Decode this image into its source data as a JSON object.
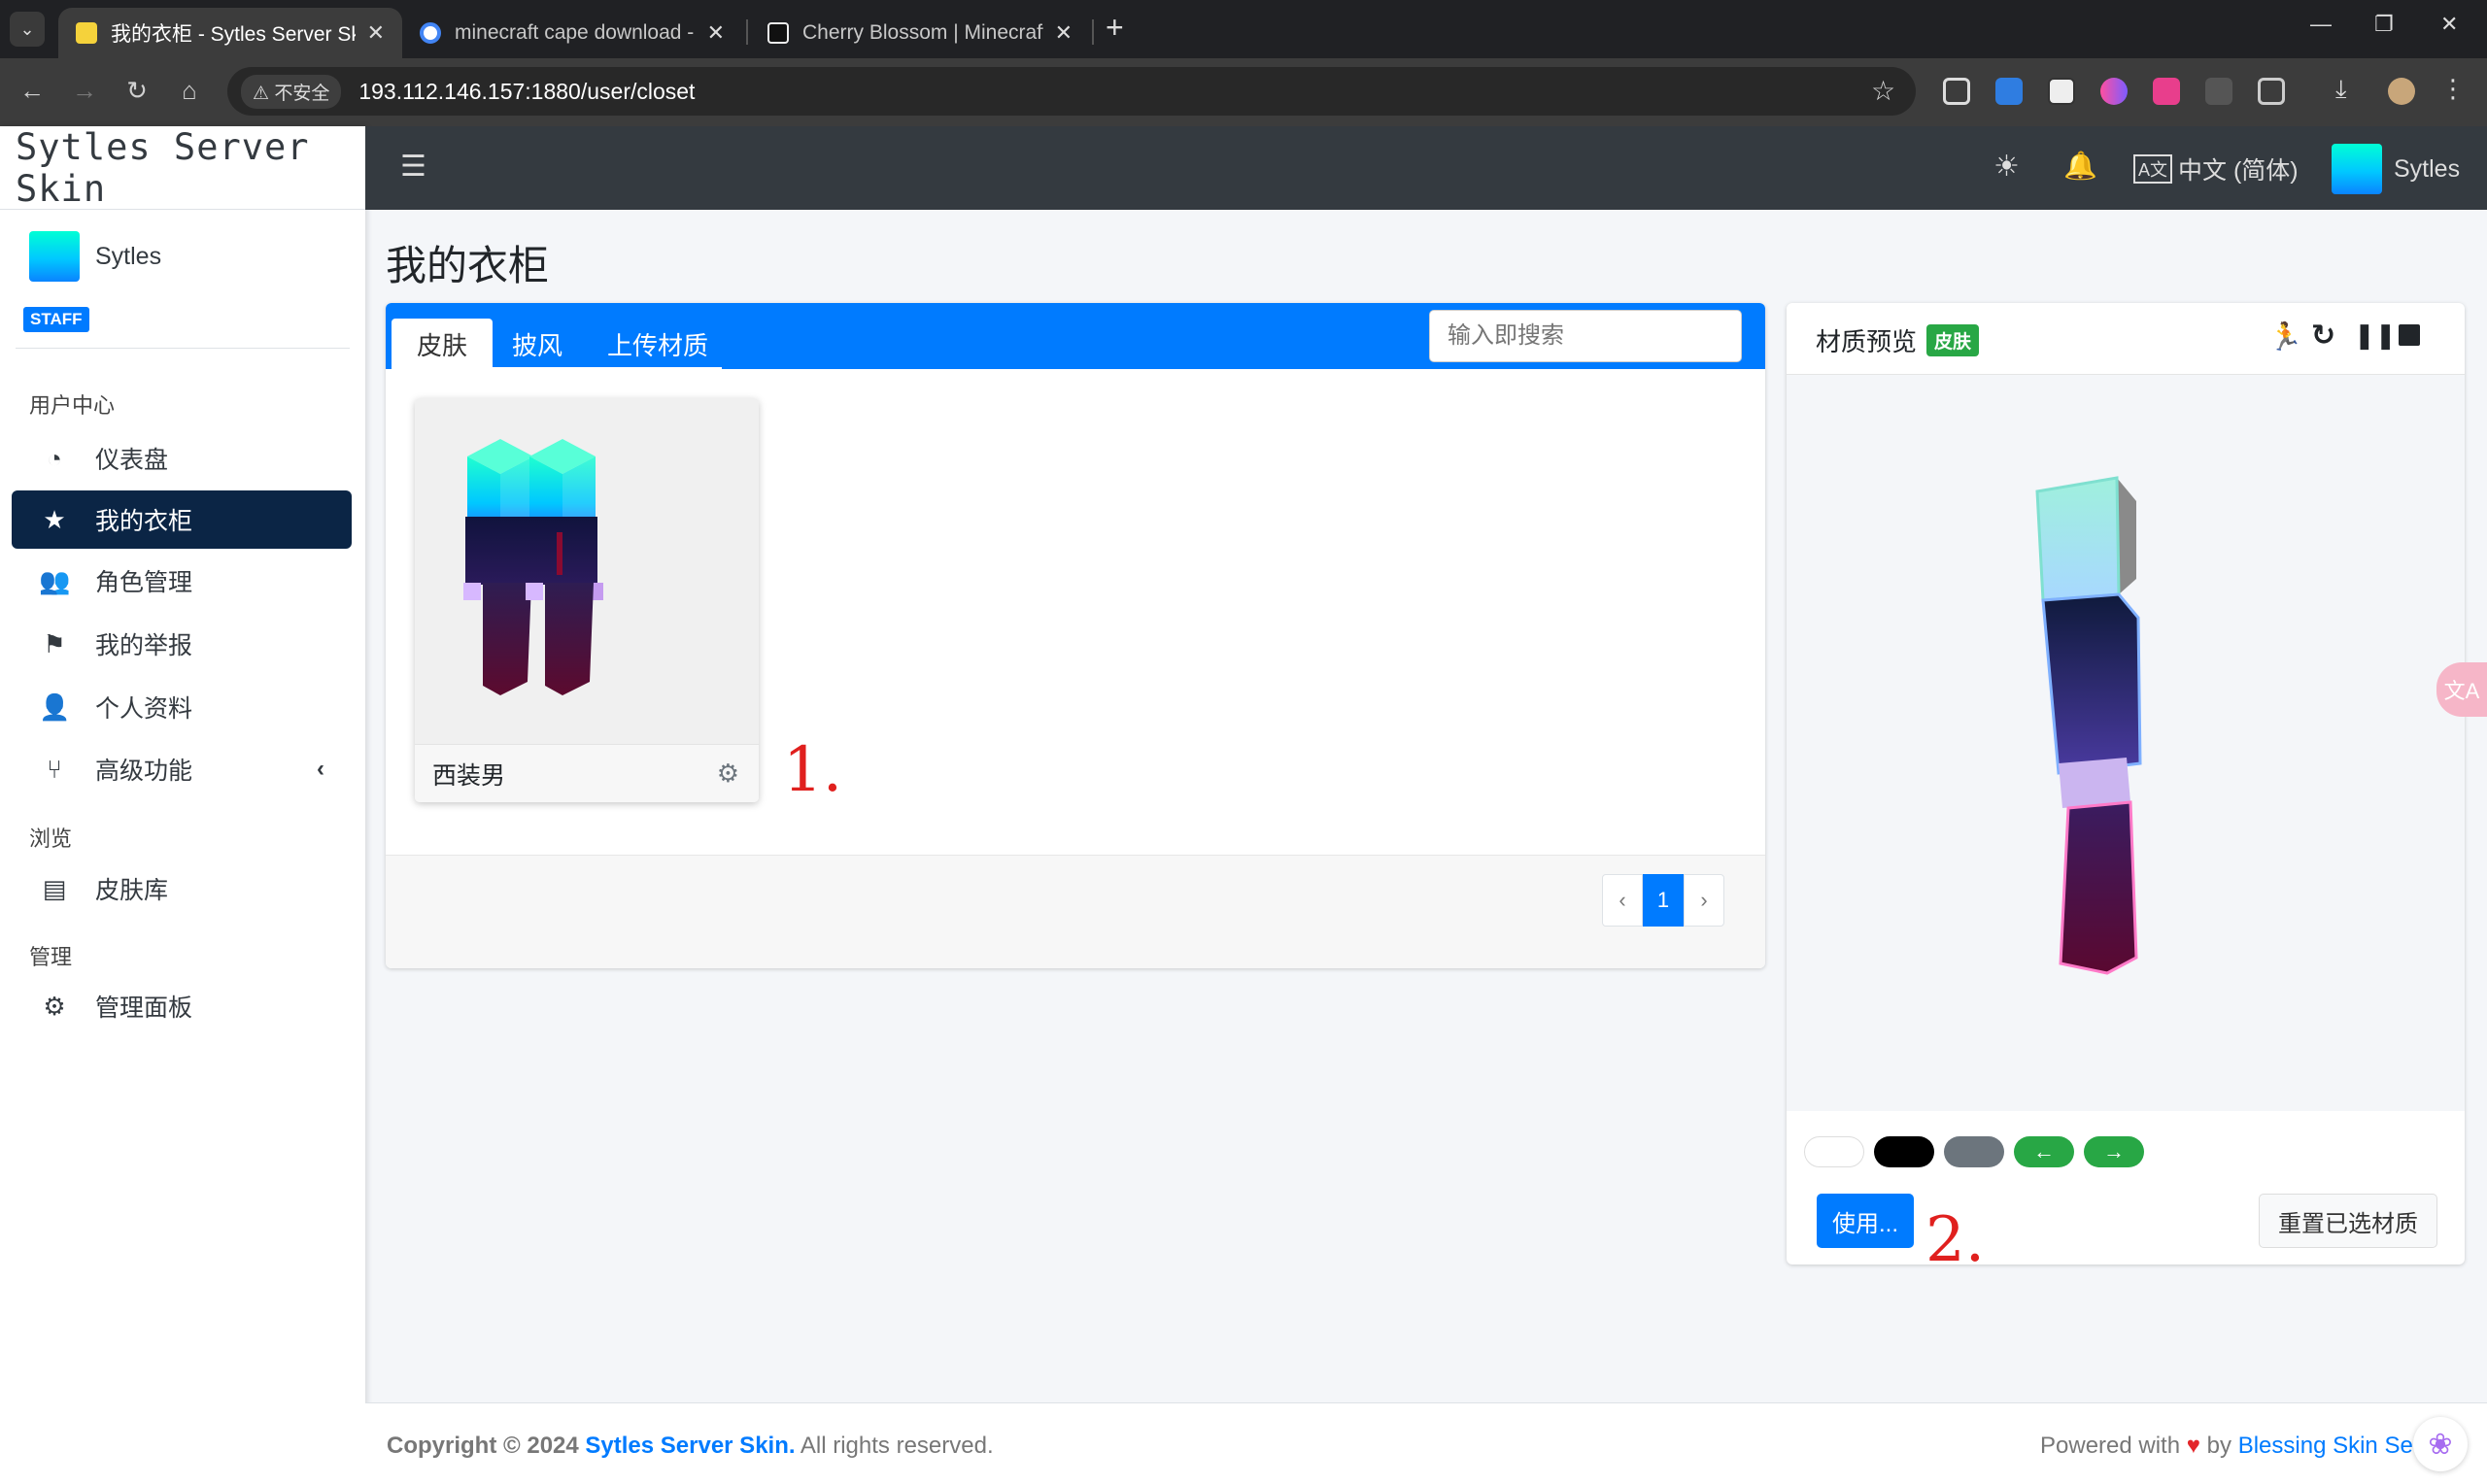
{
  "browser": {
    "tabs": [
      {
        "title": "我的衣柜 - Sytles Server Skin",
        "active": true
      },
      {
        "title": "minecraft cape download - G",
        "active": false
      },
      {
        "title": "Cherry Blossom | Minecraft C",
        "active": false
      }
    ],
    "new_tab": "+",
    "window_controls": {
      "minimize": "—",
      "restore": "❐",
      "close": "✕"
    },
    "security_label": "不安全",
    "url": "193.112.146.157:1880/user/closet"
  },
  "sidebar": {
    "brand": "Sytles Server Skin",
    "user_name": "Sytles",
    "user_badge": "STAFF",
    "section_user": "用户中心",
    "items_user": [
      {
        "label": "仪表盘",
        "icon": "dashboard-icon",
        "active": false
      },
      {
        "label": "我的衣柜",
        "icon": "star-icon",
        "active": true
      },
      {
        "label": "角色管理",
        "icon": "users-icon",
        "active": false
      },
      {
        "label": "我的举报",
        "icon": "flag-icon",
        "active": false
      },
      {
        "label": "个人资料",
        "icon": "user-icon",
        "active": false
      },
      {
        "label": "高级功能",
        "icon": "branch-icon",
        "active": false
      }
    ],
    "section_browse": "浏览",
    "items_browse": [
      {
        "label": "皮肤库",
        "icon": "archive-icon"
      }
    ],
    "section_admin": "管理",
    "items_admin": [
      {
        "label": "管理面板",
        "icon": "gear-icon"
      }
    ]
  },
  "navbar": {
    "language": "中文 (简体)",
    "user_name": "Sytles"
  },
  "main": {
    "page_title": "我的衣柜",
    "tabs": [
      "皮肤",
      "披风",
      "上传材质"
    ],
    "active_tab": "皮肤",
    "search_placeholder": "输入即搜索",
    "items": [
      {
        "name": "西装男"
      }
    ],
    "pagination": {
      "prev": "‹",
      "current": "1",
      "next": "›"
    }
  },
  "preview": {
    "title": "材质预览",
    "badge": "皮肤",
    "use_button": "使用...",
    "reset_button": "重置已选材质"
  },
  "annotations": {
    "note1": "1.",
    "note2": "2."
  },
  "footer": {
    "copyright_prefix": "Copyright © 2024 ",
    "site_name": "Sytles Server Skin.",
    "rights": " All rights reserved.",
    "powered_prefix": "Powered with",
    "powered_by": "by",
    "powered_link": "Blessing Skin Se"
  },
  "colors": {
    "primary": "#007bff",
    "sidebar_active": "#0b2545",
    "navbar": "#343a40",
    "success": "#28a745"
  }
}
